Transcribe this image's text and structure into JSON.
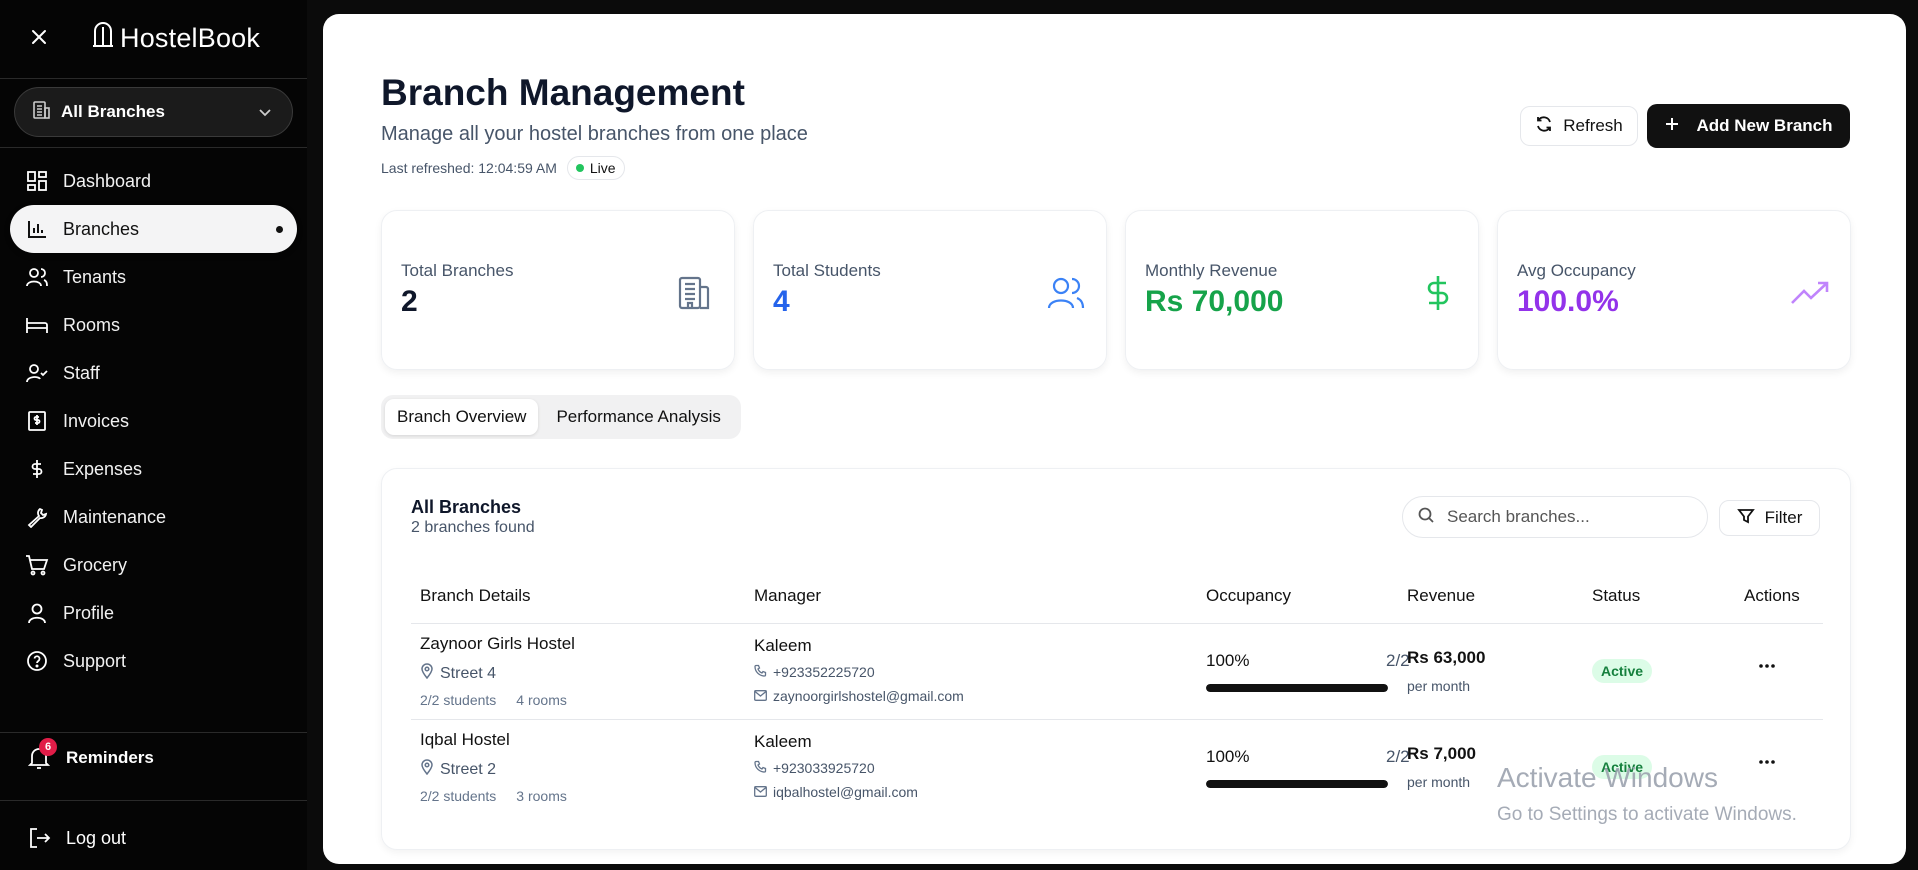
{
  "app": {
    "name": "HostelBook"
  },
  "branch_selector": {
    "label": "All Branches"
  },
  "nav": [
    {
      "label": "Dashboard",
      "icon": "dashboard-icon"
    },
    {
      "label": "Branches",
      "icon": "bar-chart-icon",
      "active": true
    },
    {
      "label": "Tenants",
      "icon": "users-icon"
    },
    {
      "label": "Rooms",
      "icon": "bed-icon"
    },
    {
      "label": "Staff",
      "icon": "user-check-icon"
    },
    {
      "label": "Invoices",
      "icon": "invoice-icon"
    },
    {
      "label": "Expenses",
      "icon": "dollar-icon"
    },
    {
      "label": "Maintenance",
      "icon": "wrench-icon"
    },
    {
      "label": "Grocery",
      "icon": "cart-icon"
    },
    {
      "label": "Profile",
      "icon": "user-icon"
    },
    {
      "label": "Support",
      "icon": "help-icon"
    }
  ],
  "reminders": {
    "label": "Reminders",
    "count": "6"
  },
  "logout": {
    "label": "Log out"
  },
  "header": {
    "title": "Branch Management",
    "subtitle": "Manage all your hostel branches from one place",
    "last_refreshed": "Last refreshed: 12:04:59 AM",
    "live": "Live",
    "refresh_label": "Refresh",
    "add_label": "Add New Branch"
  },
  "stats": [
    {
      "label": "Total Branches",
      "value": "2",
      "color": "#0f172a",
      "icon": "building-icon"
    },
    {
      "label": "Total Students",
      "value": "4",
      "color": "#2563eb",
      "icon": "users-icon"
    },
    {
      "label": "Monthly Revenue",
      "value": "Rs 70,000",
      "color": "#16a34a",
      "icon": "dollar-icon"
    },
    {
      "label": "Avg Occupancy",
      "value": "100.0%",
      "color": "#9333ea",
      "icon": "trending-up-icon"
    }
  ],
  "tabs": [
    "Branch Overview",
    "Performance Analysis"
  ],
  "table": {
    "title": "All Branches",
    "subtitle": "2 branches found",
    "search_placeholder": "Search branches...",
    "filter_label": "Filter",
    "columns": [
      "Branch Details",
      "Manager",
      "Occupancy",
      "Revenue",
      "Status",
      "Actions"
    ],
    "rows": [
      {
        "name": "Zaynoor Girls Hostel",
        "location": "Street 4",
        "students": "2/2 students",
        "rooms": "4 rooms",
        "manager": "Kaleem",
        "phone": "+923352225720",
        "email": "zaynoorgirlshostel@gmail.com",
        "occupancy_pct": "100%",
        "occupancy_frac": "2/2",
        "occupancy_value": 100,
        "revenue": "Rs 63,000",
        "revenue_sub": "per month",
        "status": "Active"
      },
      {
        "name": "Iqbal Hostel",
        "location": "Street 2",
        "students": "2/2 students",
        "rooms": "3 rooms",
        "manager": "Kaleem",
        "phone": "+923033925720",
        "email": "iqbalhostel@gmail.com",
        "occupancy_pct": "100%",
        "occupancy_frac": "2/2",
        "occupancy_value": 100,
        "revenue": "Rs 7,000",
        "revenue_sub": "per month",
        "status": "Active"
      }
    ]
  },
  "watermark": {
    "line1": "Activate Windows",
    "line2": "Go to Settings to activate Windows."
  }
}
